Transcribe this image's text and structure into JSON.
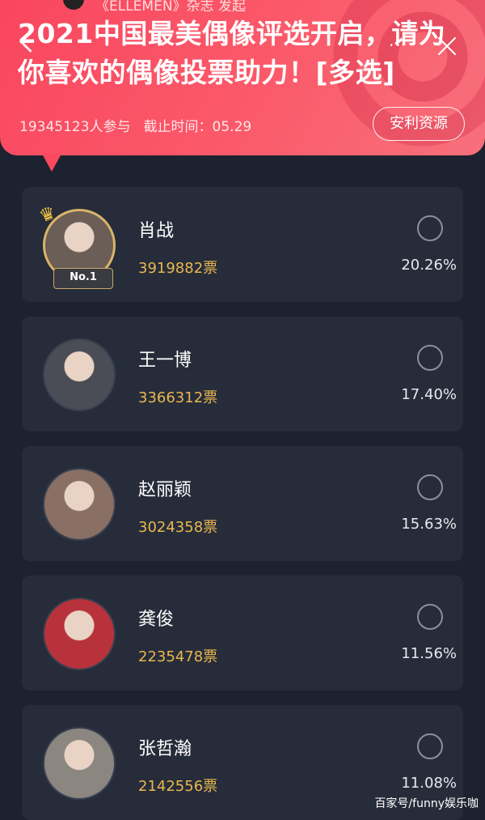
{
  "header": {
    "top_strip": "《ELLEMEN》杂志 发起",
    "title": "2021中国最美偶像评选开启，请为你喜欢的偶像投票助力！[多选]",
    "participants": "19345123人参与",
    "deadline": "截止时间：05.29",
    "resource_button": "安利资源",
    "more_label": "··"
  },
  "candidates": [
    {
      "name": "肖战",
      "votes": "3919882票",
      "percent": "20.26%",
      "rank": "No.1",
      "avatar_color": "#6b5e56"
    },
    {
      "name": "王一博",
      "votes": "3366312票",
      "percent": "17.40%",
      "avatar_color": "#4a4d55"
    },
    {
      "name": "赵丽颖",
      "votes": "3024358票",
      "percent": "15.63%",
      "avatar_color": "#8a6f65"
    },
    {
      "name": "龚俊",
      "votes": "2235478票",
      "percent": "11.56%",
      "avatar_color": "#b8323c"
    },
    {
      "name": "张哲瀚",
      "votes": "2142556票",
      "percent": "11.08%",
      "avatar_color": "#8b8680"
    }
  ],
  "watermark": "百家号/funny娱乐咖"
}
